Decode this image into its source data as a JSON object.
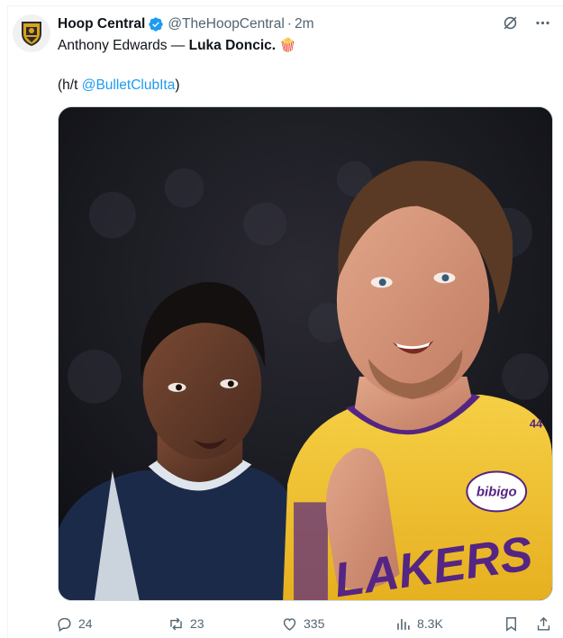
{
  "tweet": {
    "author": {
      "display_name": "Hoop Central",
      "handle": "@TheHoopCentral",
      "verified": true
    },
    "time_separator": "·",
    "time": "2m",
    "text": {
      "plain_part": "Anthony Edwards — ",
      "bold_part": "Luka Doncic.",
      "emoji": "🍿",
      "credit_prefix": "(h/t ",
      "credit_mention": "@BulletClubIta",
      "credit_suffix": ")"
    },
    "media": {
      "jersey_sponsor": "bibigo",
      "jersey_number": "44",
      "jersey_wordmark": "LAKERS",
      "jersey_colors": {
        "gold": "#f4c531",
        "purple": "#552583",
        "navy": "#1c2a4a"
      }
    },
    "actions": {
      "replies": "24",
      "retweets": "23",
      "likes": "335",
      "views": "8.3K"
    }
  },
  "colors": {
    "accent": "#1d9bf0",
    "muted": "#536471",
    "text": "#0f1419"
  }
}
